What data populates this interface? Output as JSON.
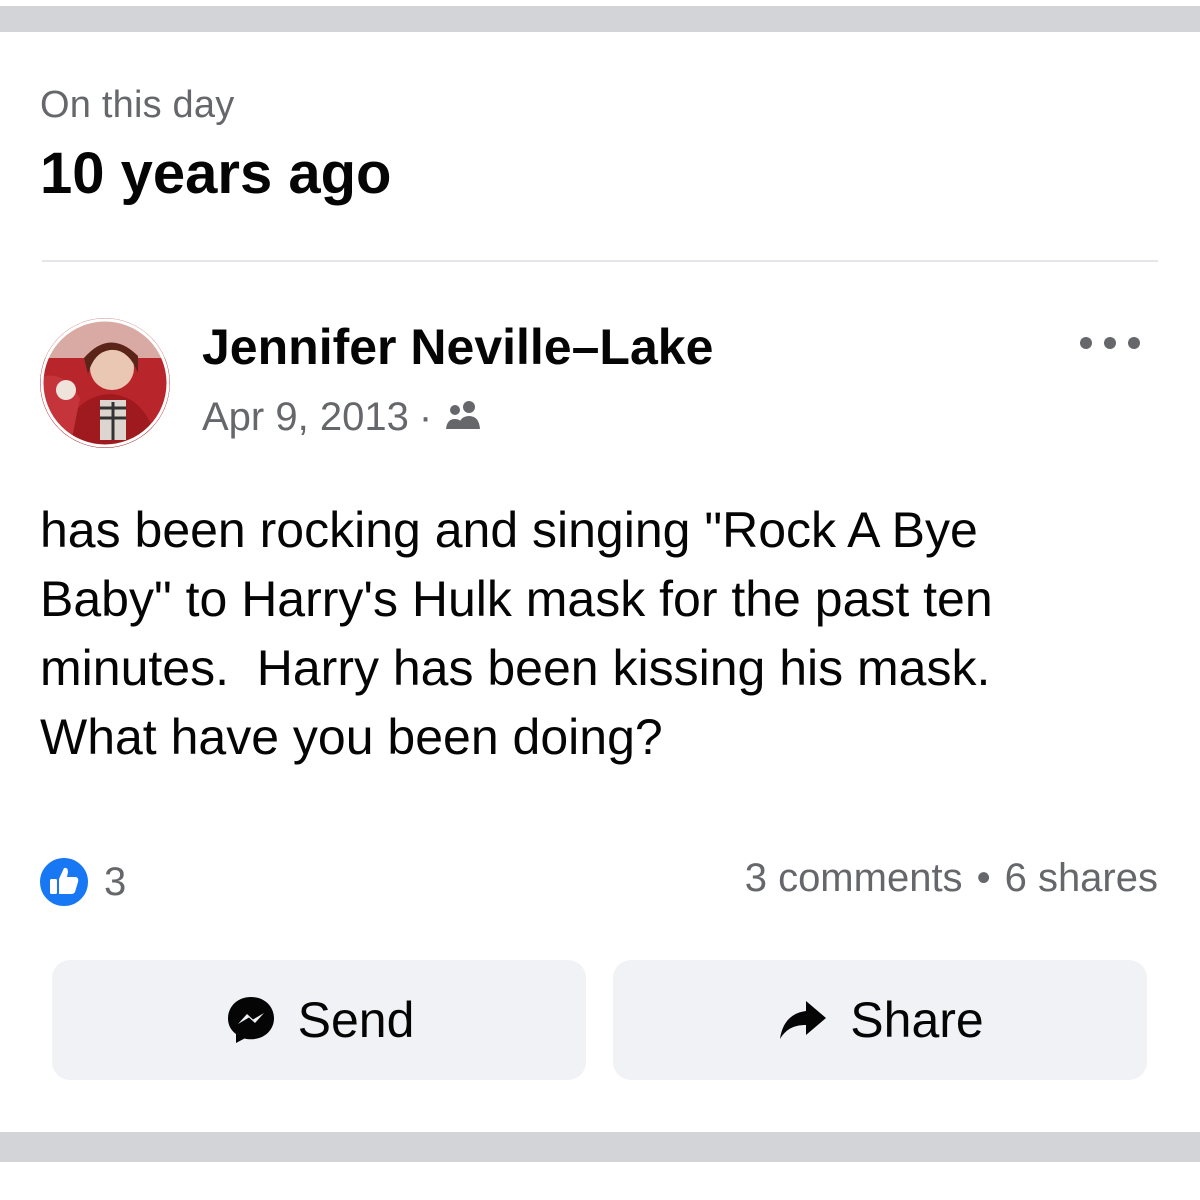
{
  "memory": {
    "kicker": "On this day",
    "heading": "10 years ago"
  },
  "post": {
    "author": "Jennifer Neville–Lake",
    "date": "Apr 9, 2013",
    "meta_separator": "·",
    "audience_icon": "friends-icon",
    "text_lines": [
      "has been rocking and singing \"Rock A Bye",
      "Baby\" to Harry's Hulk mask for the past ten",
      "minutes.  Harry has been kissing his mask.",
      "What have you been doing?"
    ]
  },
  "stats": {
    "like_count": "3",
    "comments": "3 comments",
    "separator": "•",
    "shares": "6 shares"
  },
  "actions": {
    "send_label": "Send",
    "share_label": "Share"
  },
  "colors": {
    "primary_text": "#050505",
    "secondary_text": "#65676b",
    "like_blue": "#1877f2",
    "button_bg": "#f0f2f5",
    "band": "#d2d4d8"
  }
}
